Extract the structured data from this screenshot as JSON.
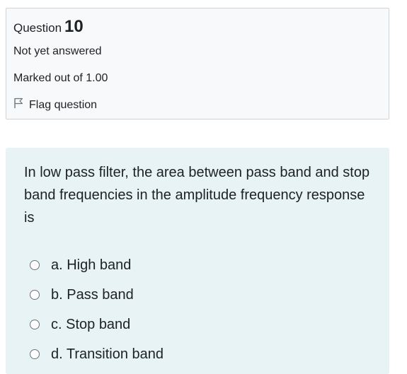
{
  "info": {
    "question_label": "Question",
    "question_number": "10",
    "status": "Not yet answered",
    "grade": "Marked out of 1.00",
    "flag_label": "Flag question"
  },
  "question": {
    "text": "In low pass filter, the area between pass band and stop band frequencies in the amplitude frequency response is",
    "options": [
      {
        "label": "a. High band"
      },
      {
        "label": "b. Pass band"
      },
      {
        "label": "c. Stop band"
      },
      {
        "label": "d. Transition band"
      }
    ]
  },
  "icons": {
    "flag": "flag-icon",
    "radio": "radio-unchecked-icon"
  },
  "colors": {
    "info_background": "#f8f9fa",
    "content_background": "#e7f3f5",
    "text": "#1d2125"
  }
}
